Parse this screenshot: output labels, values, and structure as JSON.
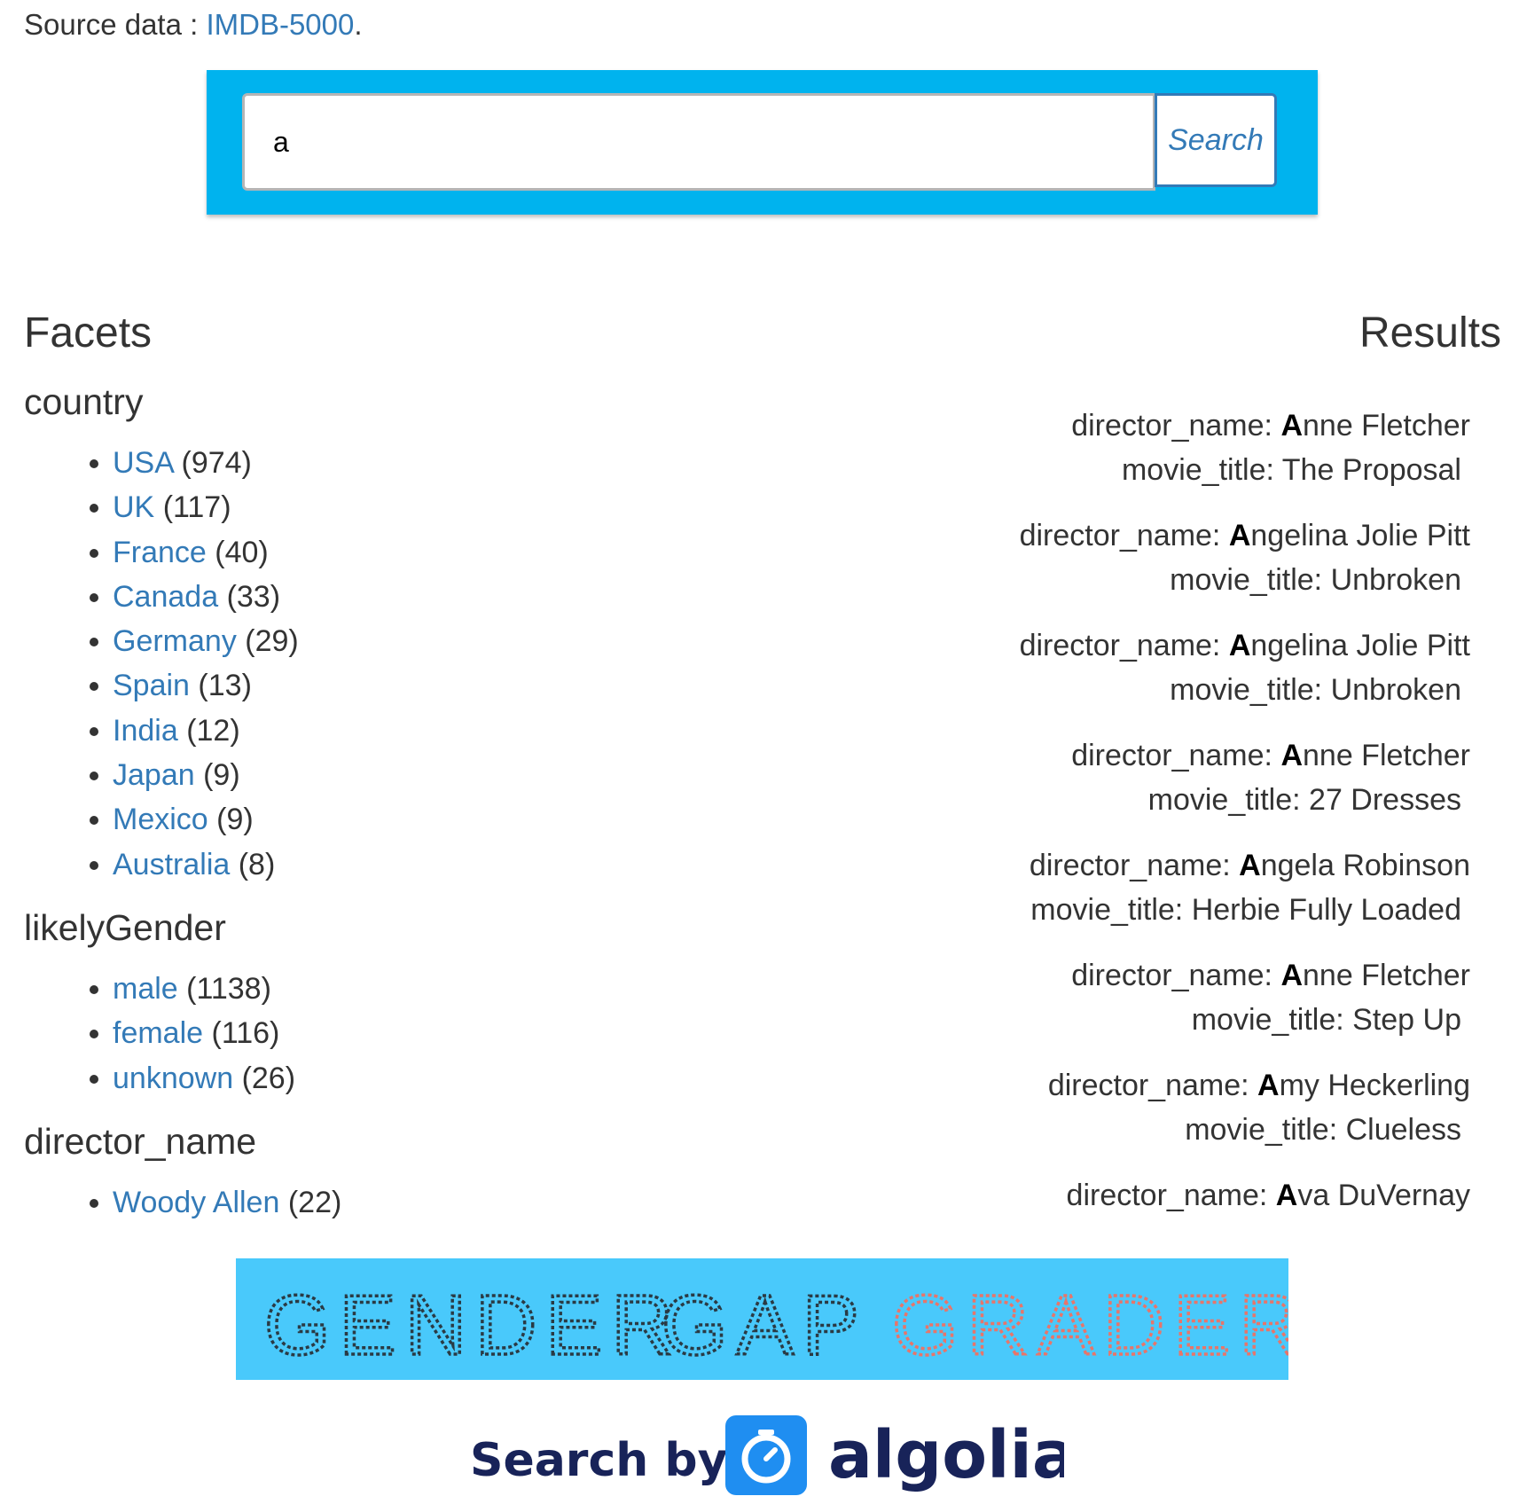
{
  "source": {
    "prefix": "Source data : ",
    "link_text": "IMDB-5000",
    "suffix": "."
  },
  "search": {
    "value": "a",
    "button_label": "Search"
  },
  "facets": {
    "title": "Facets",
    "groups": [
      {
        "name": "country",
        "items": [
          {
            "label": "USA",
            "count": "(974)"
          },
          {
            "label": "UK",
            "count": "(117)"
          },
          {
            "label": "France",
            "count": "(40)"
          },
          {
            "label": "Canada",
            "count": "(33)"
          },
          {
            "label": "Germany",
            "count": "(29)"
          },
          {
            "label": "Spain",
            "count": "(13)"
          },
          {
            "label": "India",
            "count": "(12)"
          },
          {
            "label": "Japan",
            "count": "(9)"
          },
          {
            "label": "Mexico",
            "count": "(9)"
          },
          {
            "label": "Australia",
            "count": "(8)"
          }
        ]
      },
      {
        "name": "likelyGender",
        "items": [
          {
            "label": "male",
            "count": "(1138)"
          },
          {
            "label": "female",
            "count": "(116)"
          },
          {
            "label": "unknown",
            "count": "(26)"
          }
        ]
      },
      {
        "name": "director_name",
        "items": [
          {
            "label": "Woody Allen",
            "count": "(22)"
          }
        ]
      }
    ]
  },
  "results": {
    "title": "Results",
    "director_label": "director_name: ",
    "title_label": "movie_title: ",
    "items": [
      {
        "highlight": "A",
        "director_rest": "nne Fletcher",
        "movie_title": "The Proposal"
      },
      {
        "highlight": "A",
        "director_rest": "ngelina Jolie Pitt",
        "movie_title": "Unbroken"
      },
      {
        "highlight": "A",
        "director_rest": "ngelina Jolie Pitt",
        "movie_title": "Unbroken"
      },
      {
        "highlight": "A",
        "director_rest": "nne Fletcher",
        "movie_title": "27 Dresses"
      },
      {
        "highlight": "A",
        "director_rest": "ngela Robinson",
        "movie_title": "Herbie Fully Loaded"
      },
      {
        "highlight": "A",
        "director_rest": "nne Fletcher",
        "movie_title": "Step Up"
      },
      {
        "highlight": "A",
        "director_rest": "my Heckerling",
        "movie_title": "Clueless"
      },
      {
        "highlight": "A",
        "director_rest": "va DuVernay",
        "movie_title": ""
      }
    ]
  },
  "banner": {
    "word1": "GENDER",
    "word2": "GAP",
    "word3": "GRADER",
    "bg_color": "#49c9fb",
    "dark_color": "#2a3a44",
    "accent_color": "#e8756a"
  },
  "algolia": {
    "prefix": "Search by",
    "brand": "algolia",
    "icon": "stopwatch-icon",
    "brand_color": "#182359",
    "icon_color": "#1f8ef1"
  },
  "colors": {
    "link": "#337ab7",
    "search_panel": "#00b3ee"
  }
}
